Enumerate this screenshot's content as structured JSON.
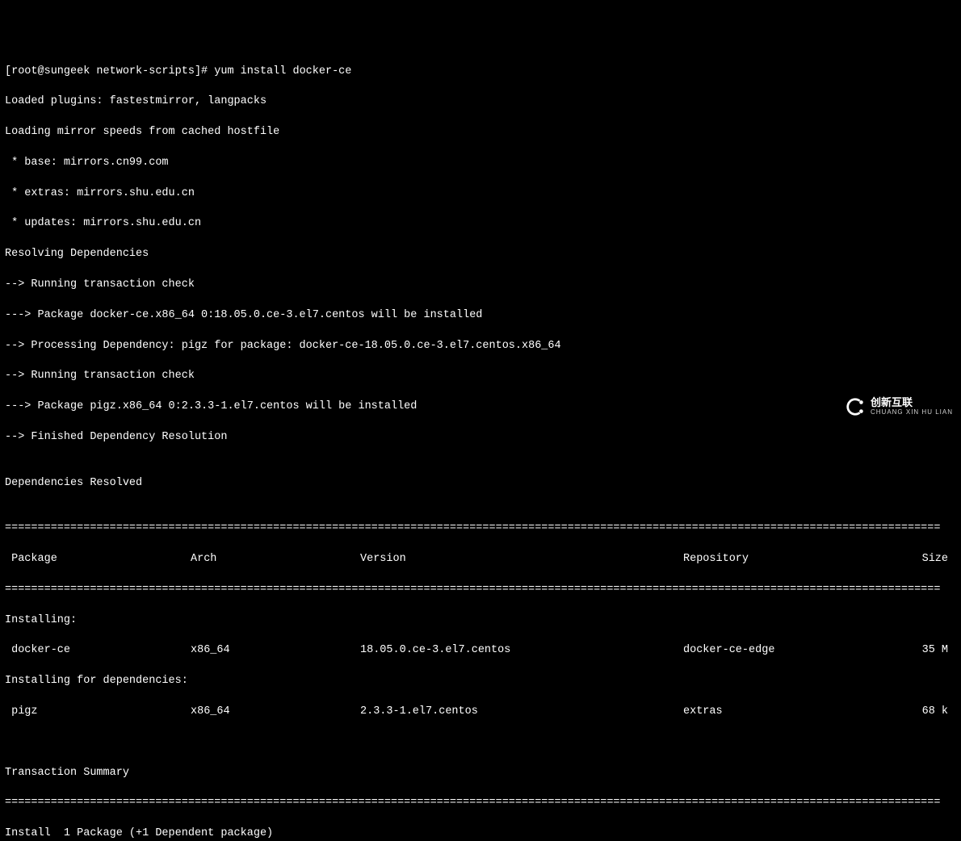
{
  "prompt": "[root@sungeek network-scripts]# ",
  "command": "yum install docker-ce",
  "lines": {
    "l1": "Loaded plugins: fastestmirror, langpacks",
    "l2": "Loading mirror speeds from cached hostfile",
    "l3": " * base: mirrors.cn99.com",
    "l4": " * extras: mirrors.shu.edu.cn",
    "l5": " * updates: mirrors.shu.edu.cn",
    "l6": "Resolving Dependencies",
    "l7": "--> Running transaction check",
    "l8": "---> Package docker-ce.x86_64 0:18.05.0.ce-3.el7.centos will be installed",
    "l9": "--> Processing Dependency: pigz for package: docker-ce-18.05.0.ce-3.el7.centos.x86_64",
    "l10": "--> Running transaction check",
    "l11": "---> Package pigz.x86_64 0:2.3.3-1.el7.centos will be installed",
    "l12": "--> Finished Dependency Resolution",
    "l13": "",
    "l14": "Dependencies Resolved",
    "l15": ""
  },
  "separator": "===============================================================================================================================================",
  "headers": {
    "package": " Package",
    "arch": "Arch",
    "version": "Version",
    "repository": "Repository",
    "size": "Size"
  },
  "installing_label": "Installing:",
  "installing_deps_label": "Installing for dependencies:",
  "packages": {
    "p1": {
      "name": " docker-ce",
      "arch": "x86_64",
      "version": "18.05.0.ce-3.el7.centos",
      "repo": "docker-ce-edge",
      "size": "35 M"
    },
    "p2": {
      "name": " pigz",
      "arch": "x86_64",
      "version": "2.3.3-1.el7.centos",
      "repo": "extras",
      "size": "68 k"
    }
  },
  "transaction_summary": "Transaction Summary",
  "install_summary": "Install  1 Package (+1 Dependent package)",
  "watermark": {
    "icon": "C",
    "cn": "创新互联",
    "en": "CHUANG XIN HU LIAN"
  }
}
